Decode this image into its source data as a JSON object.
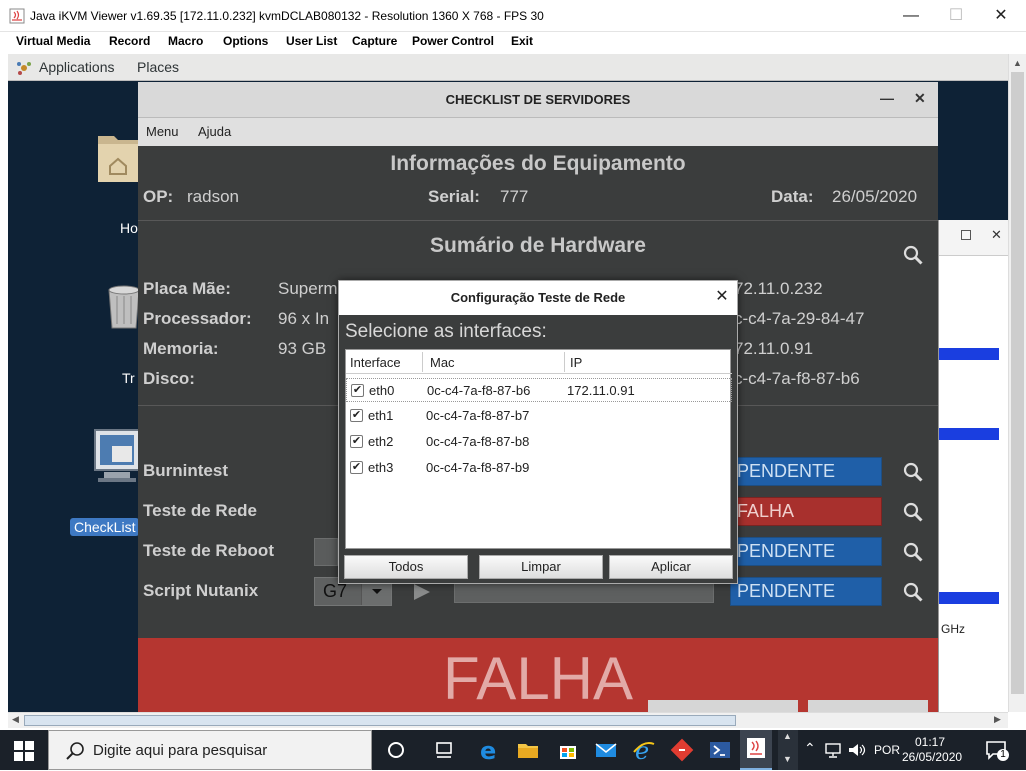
{
  "window": {
    "title": "Java iKVM Viewer v1.69.35 [172.11.0.232] kvmDCLAB080132 - Resolution 1360 X 768 - FPS 30",
    "menu": [
      "Virtual Media",
      "Record",
      "Macro",
      "Options",
      "User List",
      "Capture",
      "Power Control",
      "Exit"
    ]
  },
  "gnome": {
    "applications": "Applications",
    "places": "Places"
  },
  "desktop": {
    "home_label": "Ho",
    "trash_label": "Tr",
    "checklist_label": "CheckList"
  },
  "checklist": {
    "title": "CHECKLIST DE SERVIDORES",
    "menu": [
      "Menu",
      "Ajuda"
    ],
    "info_heading": "Informações do Equipamento",
    "op_label": "OP:",
    "op_value": "radson",
    "serial_label": "Serial:",
    "serial_value": "777",
    "data_label": "Data:",
    "data_value": "26/05/2020",
    "hw_heading": "Sumário de Hardware",
    "hw": [
      {
        "label": "Placa Mãe:",
        "value": "Superm",
        "right": "72.11.0.232"
      },
      {
        "label": "Processador:",
        "value": "96 x In",
        "right": "c-c4-7a-29-84-47"
      },
      {
        "label": "Memoria:",
        "value": "93 GB",
        "right": "72.11.0.91"
      },
      {
        "label": "Disco:",
        "value": "",
        "right": "c-c4-7a-f8-87-b6"
      }
    ],
    "tests": [
      {
        "label": "Burnintest",
        "status": "PENDENTE",
        "color": "#1f5fa8"
      },
      {
        "label": "Teste de Rede",
        "status": "FALHA",
        "color": "#a8302d"
      },
      {
        "label": "Teste de Reboot",
        "status": "PENDENTE",
        "color": "#1f5fa8"
      },
      {
        "label": "Script Nutanix",
        "status": "PENDENTE",
        "color": "#1f5fa8"
      }
    ],
    "script_select": "G7",
    "result": "FALHA"
  },
  "dialog": {
    "title": "Configuração Teste de Rede",
    "prompt": "Selecione as interfaces:",
    "columns": [
      "Interface",
      "Mac",
      "IP"
    ],
    "rows": [
      {
        "iface": "eth0",
        "mac": "0c-c4-7a-f8-87-b6",
        "ip": "172.11.0.91",
        "checked": true
      },
      {
        "iface": "eth1",
        "mac": "0c-c4-7a-f8-87-b7",
        "ip": "",
        "checked": true
      },
      {
        "iface": "eth2",
        "mac": "0c-c4-7a-f8-87-b8",
        "ip": "",
        "checked": true
      },
      {
        "iface": "eth3",
        "mac": "0c-c4-7a-f8-87-b9",
        "ip": "",
        "checked": true
      }
    ],
    "buttons": {
      "all": "Todos",
      "clear": "Limpar",
      "apply": "Aplicar"
    }
  },
  "right_window": {
    "ghz": "GHz"
  },
  "taskbar": {
    "search_placeholder": "Digite aqui para pesquisar",
    "lang": "POR",
    "time": "01:17",
    "date": "26/05/2020",
    "notifications": "1"
  }
}
